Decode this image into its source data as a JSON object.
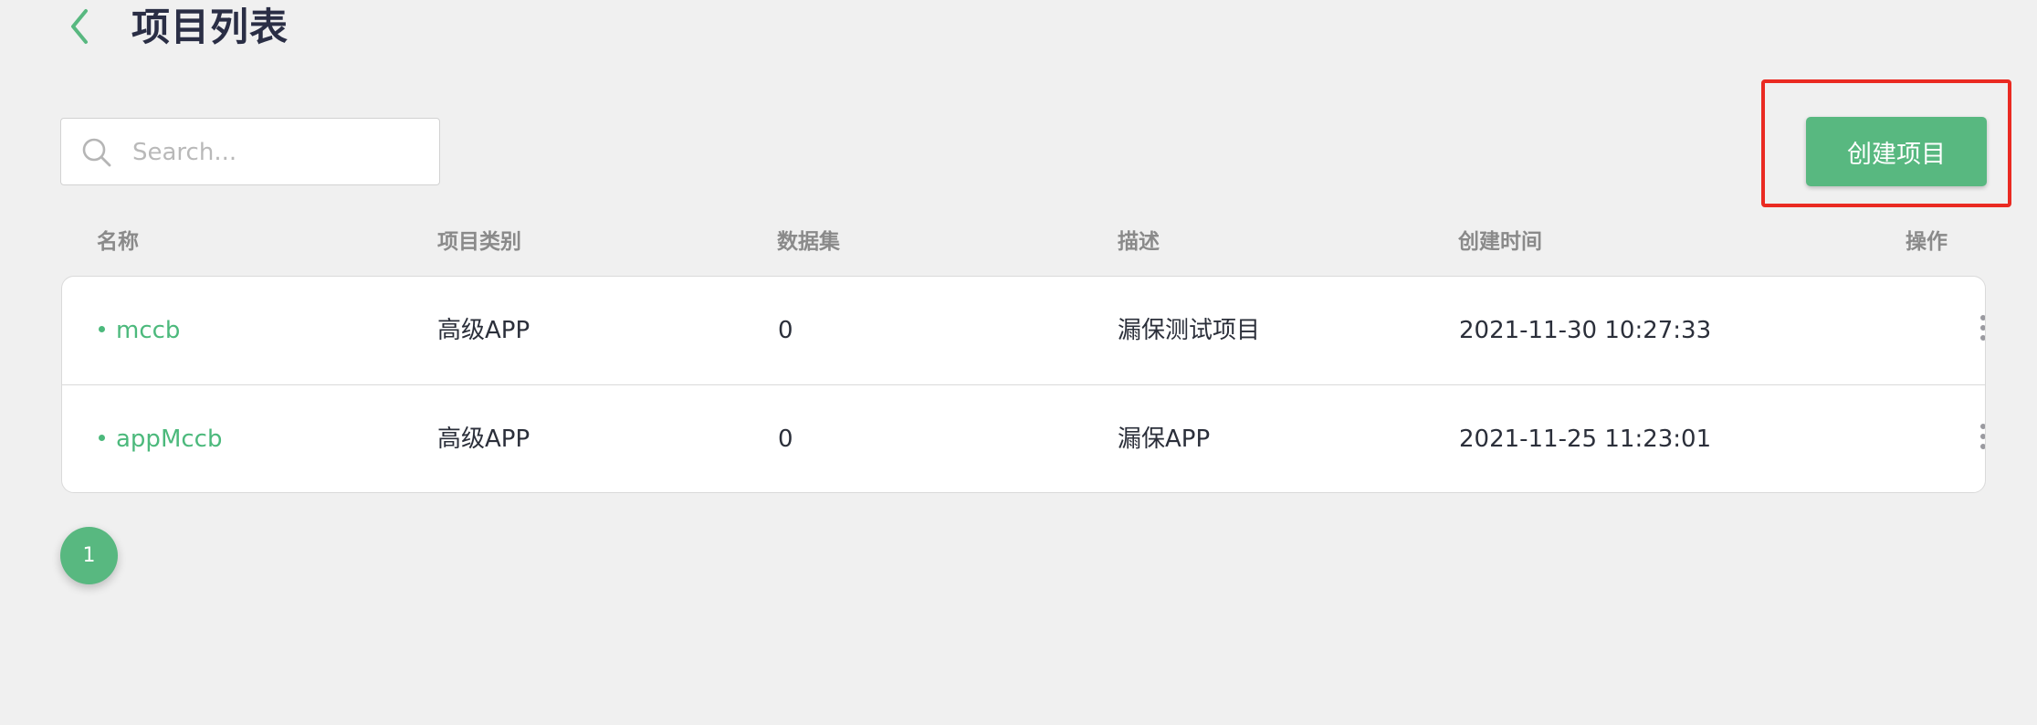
{
  "header": {
    "back_icon": "chevron-left-icon",
    "title": "项目列表"
  },
  "search": {
    "icon": "search-icon",
    "placeholder": "Search...",
    "value": ""
  },
  "toolbar": {
    "create_label": "创建项目"
  },
  "table": {
    "columns": [
      "名称",
      "项目类别",
      "数据集",
      "描述",
      "创建时间",
      "操作"
    ],
    "rows": [
      {
        "name": "mccb",
        "category": "高级APP",
        "datasets": "0",
        "description": "漏保测试项目",
        "created_at": "2021-11-30 10:27:33",
        "action_icon": "more-vertical-icon"
      },
      {
        "name": "appMccb",
        "category": "高级APP",
        "datasets": "0",
        "description": "漏保APP",
        "created_at": "2021-11-25 11:23:01",
        "action_icon": "more-vertical-icon"
      }
    ]
  },
  "pagination": {
    "current_page": "1"
  },
  "colors": {
    "accent": "#58b880",
    "name_link": "#4cb97c",
    "highlight": "#ea2a22",
    "background": "#f0f0f0",
    "title": "#2a2e45",
    "column_header": "#8a8a8a"
  }
}
